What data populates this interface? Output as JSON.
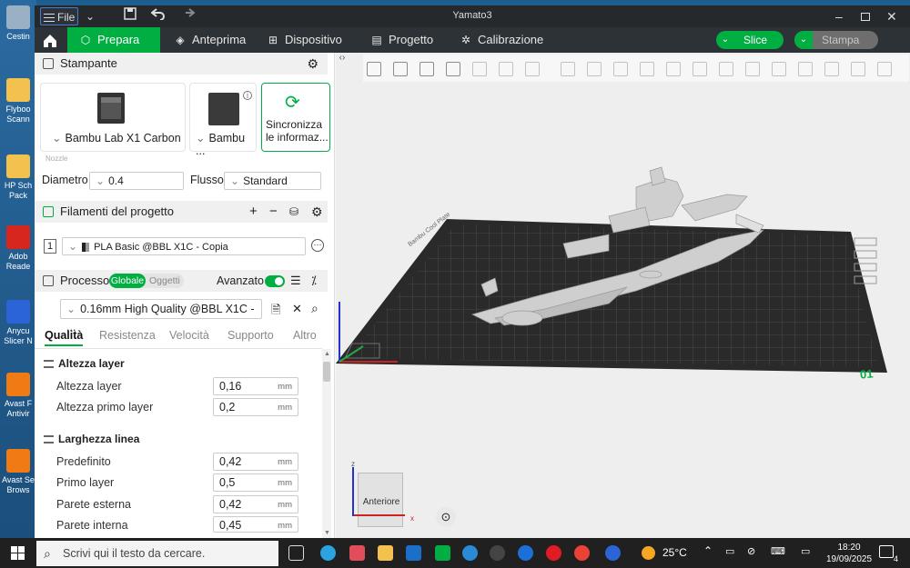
{
  "desktop": {
    "icons": [
      {
        "label": "Cestin",
        "icon": "recycle-bin-icon",
        "color": "#9ab0c4"
      },
      {
        "label": "Flyboo Scann",
        "icon": "folder-icon",
        "color": "#f2c14e"
      },
      {
        "label": "HP Sch Pack",
        "icon": "folder-icon",
        "color": "#f2c14e"
      },
      {
        "label": "Adob Reade",
        "icon": "pdf-icon",
        "color": "#d7261e"
      },
      {
        "label": "Anycu Slicer N",
        "icon": "app-icon",
        "color": "#2a64d6"
      },
      {
        "label": "Avast F Antivir",
        "icon": "avast-icon",
        "color": "#f07a13"
      },
      {
        "label": "Avast Se Brows",
        "icon": "avast-icon",
        "color": "#f07a13"
      }
    ]
  },
  "window": {
    "title": "Yamato3",
    "file_label": "File",
    "menu_icon": "hamburger-icon",
    "controls": [
      "minimize-icon",
      "maximize-icon",
      "close-icon"
    ]
  },
  "tabs": [
    {
      "label": "Prepara",
      "icon": "cube-icon",
      "active": true
    },
    {
      "label": "Anteprima",
      "icon": "layers-icon",
      "active": false
    },
    {
      "label": "Dispositivo",
      "icon": "device-icon",
      "active": false
    },
    {
      "label": "Progetto",
      "icon": "project-icon",
      "active": false
    },
    {
      "label": "Calibrazione",
      "icon": "calibration-icon",
      "active": false
    }
  ],
  "actions": {
    "slice": "Slice",
    "print": "Stampa",
    "slice_color": "#00ae42",
    "print_color": "#7c7c7c"
  },
  "printer": {
    "section_title": "Stampante",
    "printer_name": "Bambu Lab X1 Carbon",
    "plate_name": "Bambu ...",
    "sync_label_1": "Sincronizza",
    "sync_label_2": "le informaz...",
    "nozzle_label": "Nozzle",
    "diameter_label": "Diametro",
    "diameter_value": "0.4",
    "flow_label": "Flusso",
    "flow_value": "Standard"
  },
  "filaments": {
    "section_title": "Filamenti del progetto",
    "items": [
      {
        "index": "1",
        "name": "PLA Basic @BBL X1C - Copia"
      }
    ]
  },
  "process": {
    "section_title": "Processo",
    "toggle_global": "Globale",
    "toggle_objects": "Oggetti",
    "advanced_label": "Avanzato",
    "preset": "0.16mm High Quality @BBL X1C - ...",
    "subtabs": [
      "Qualità",
      "Resistenza",
      "Velocità",
      "Supporto",
      "Altro"
    ],
    "groups": [
      {
        "title": "Altezza layer",
        "rows": [
          {
            "label": "Altezza layer",
            "value": "0,16",
            "unit": "mm"
          },
          {
            "label": "Altezza primo layer",
            "value": "0,2",
            "unit": "mm"
          }
        ]
      },
      {
        "title": "Larghezza linea",
        "rows": [
          {
            "label": "Predefinito",
            "value": "0,42",
            "unit": "mm"
          },
          {
            "label": "Primo layer",
            "value": "0,5",
            "unit": "mm"
          },
          {
            "label": "Parete esterna",
            "value": "0,42",
            "unit": "mm"
          },
          {
            "label": "Parete interna",
            "value": "0,45",
            "unit": "mm"
          }
        ]
      }
    ]
  },
  "viewport": {
    "plate_number": "01",
    "view_cube_label": "Anteriore",
    "plate_label": "Bambu Cool Plate",
    "axis_x": "x",
    "axis_z": "z"
  },
  "taskbar": {
    "search_placeholder": "Scrivi qui il testo da cercare.",
    "weather": "25°C",
    "time": "18:20",
    "date": "19/09/2025",
    "notification_count": "4"
  }
}
